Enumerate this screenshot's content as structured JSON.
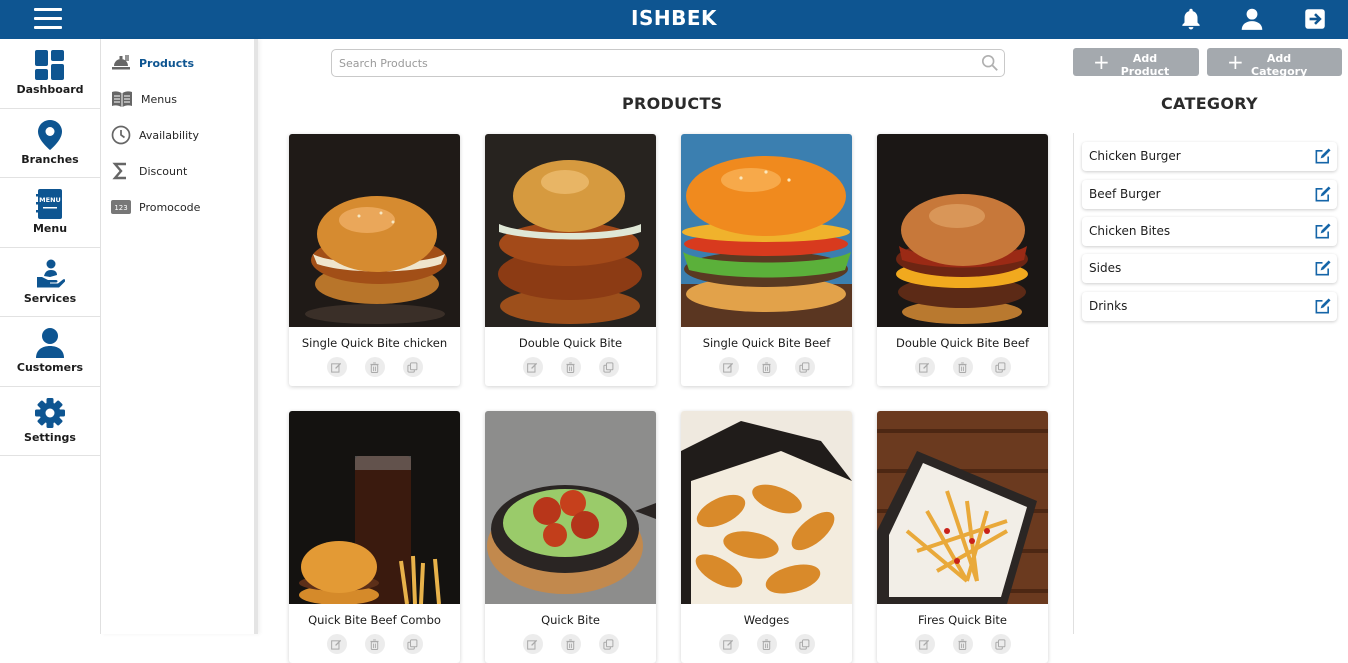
{
  "header": {
    "title": "ISHBEK",
    "menu_icon": "hamburger-icon",
    "icons": [
      "bell-icon",
      "user-icon",
      "logout-icon"
    ]
  },
  "rail": {
    "items": [
      {
        "label": "Dashboard",
        "icon": "dashboard-icon"
      },
      {
        "label": "Branches",
        "icon": "map-pin-icon"
      },
      {
        "label": "Menu",
        "icon": "menu-book-icon"
      },
      {
        "label": "Services",
        "icon": "service-hand-icon"
      },
      {
        "label": "Customers",
        "icon": "person-icon"
      },
      {
        "label": "Settings",
        "icon": "gear-icon"
      }
    ]
  },
  "submenu": {
    "items": [
      {
        "label": "Products",
        "icon": "food-tray-icon",
        "active": true
      },
      {
        "label": "Menus",
        "icon": "open-book-icon"
      },
      {
        "label": "Availability",
        "icon": "clock-icon"
      },
      {
        "label": "Discount",
        "icon": "sigma-icon"
      },
      {
        "label": "Promocode",
        "icon": "number-tag-icon"
      }
    ]
  },
  "search": {
    "placeholder": "Search Products",
    "value": ""
  },
  "buttons": {
    "add_product": "Add Product",
    "add_category": "Add Category"
  },
  "products": {
    "title": "PRODUCTS",
    "items": [
      {
        "name": "Single Quick Bite chicken"
      },
      {
        "name": "Double Quick Bite"
      },
      {
        "name": "Single Quick Bite Beef"
      },
      {
        "name": "Double Quick Bite Beef"
      },
      {
        "name": "Quick Bite Beef Combo"
      },
      {
        "name": "Quick Bite"
      },
      {
        "name": "Wedges"
      },
      {
        "name": "Fires Quick Bite"
      }
    ]
  },
  "category": {
    "title": "CATEGORY",
    "items": [
      {
        "label": "Chicken Burger"
      },
      {
        "label": "Beef Burger"
      },
      {
        "label": "Chicken Bites"
      },
      {
        "label": "Sides"
      },
      {
        "label": "Drinks"
      }
    ]
  },
  "colors": {
    "brand": "#0e5591",
    "button_gray": "#a4a9ae",
    "accent_blue": "#1565a8"
  }
}
